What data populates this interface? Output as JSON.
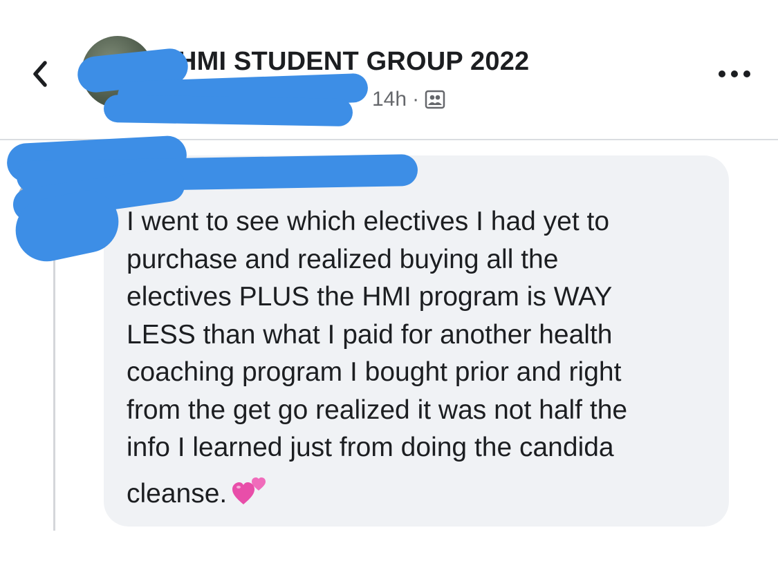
{
  "post_header": {
    "group_name": "HMI STUDENT GROUP 2022",
    "time_ago": "14h",
    "separator": "·",
    "audience_icon": "group-members-icon",
    "back_icon": "chevron-left-icon",
    "more_icon": "more-horizontal-icon"
  },
  "comment": {
    "lines": [
      "I went to see which electives I had yet to",
      "purchase and realized buying all the",
      "electives PLUS the HMI program is WAY",
      "LESS than what I paid for another health",
      "coaching program I bought prior and right",
      "from the get go realized it was not half the",
      "info I learned just from doing the candida",
      "cleanse."
    ],
    "emoji": "two-hearts-emoji"
  },
  "colors": {
    "redaction": "#3d8ee6",
    "bubble": "#f0f2f5",
    "secondary_text": "#65676b",
    "divider": "#dadde1"
  }
}
